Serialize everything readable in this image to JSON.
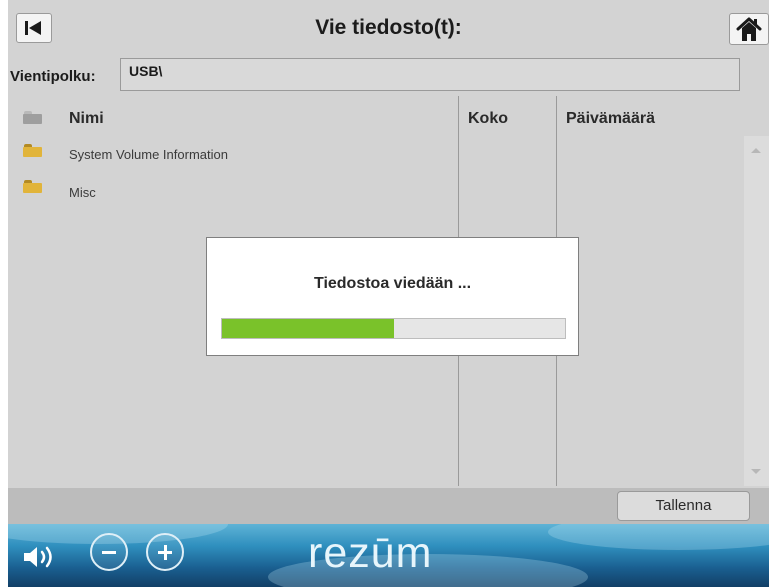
{
  "header": {
    "title": "Vie tiedosto(t):"
  },
  "export_path": {
    "label": "Vientipolku:",
    "value": "USB\\"
  },
  "file_list": {
    "columns": {
      "name": "Nimi",
      "size": "Koko",
      "date": "Päivämäärä"
    },
    "rows": [
      {
        "name": "System Volume Information",
        "icon": "folder-icon"
      },
      {
        "name": "Misc",
        "icon": "folder-icon"
      }
    ]
  },
  "dialog": {
    "message": "Tiedostoa viedään ...",
    "progress": 0.5
  },
  "save_button": {
    "label": "Tallenna"
  },
  "footer": {
    "brand": "rezūm"
  },
  "colors": {
    "accent_green": "#7ac22a",
    "panel_gray": "#d3d3d3",
    "footer_blue": "#1a5f90",
    "folder_yellow": "#e1b43a"
  },
  "icons": [
    "back-to-start-icon",
    "home-icon",
    "folder-icon",
    "speaker-icon",
    "minus-icon",
    "plus-icon"
  ]
}
